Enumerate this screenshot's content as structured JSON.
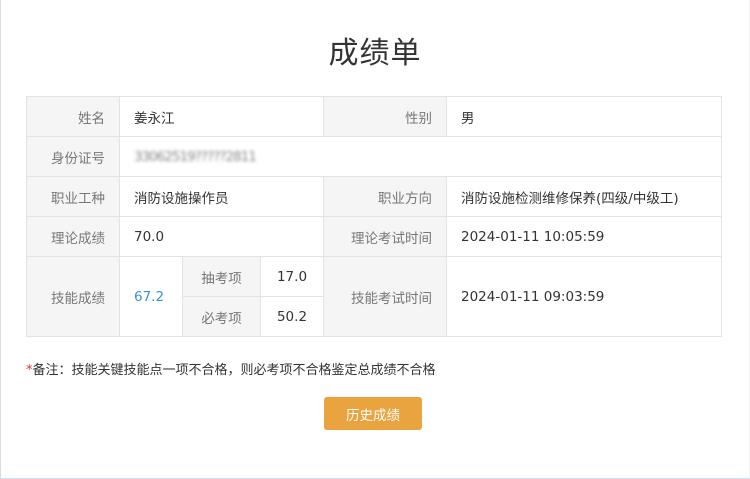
{
  "page_title": "成绩单",
  "labels": {
    "name": "姓名",
    "gender": "性别",
    "id_number": "身份证号",
    "occupation": "职业工种",
    "direction": "职业方向",
    "theory_score": "理论成绩",
    "theory_time": "理论考试时间",
    "skill_score": "技能成绩",
    "skill_time": "技能考试时间",
    "sample_item": "抽考项",
    "required_item": "必考项"
  },
  "values": {
    "name": "姜永江",
    "gender": "男",
    "id_number": "33062519?????2811",
    "occupation": "消防设施操作员",
    "direction": "消防设施检测维修保养(四级/中级工)",
    "theory_score": "70.0",
    "theory_time": "2024-01-11 10:05:59",
    "skill_score": "67.2",
    "sample_item_score": "17.0",
    "required_item_score": "50.2",
    "skill_time": "2024-01-11 09:03:59"
  },
  "note": {
    "star": "*",
    "text": "备注：技能关键技能点一项不合格，则必考项不合格鉴定总成绩不合格"
  },
  "history_button": "历史成绩",
  "colors": {
    "accent_button": "#e9a440",
    "skill_score": "#3b8fd9",
    "required_star": "#e03131"
  }
}
